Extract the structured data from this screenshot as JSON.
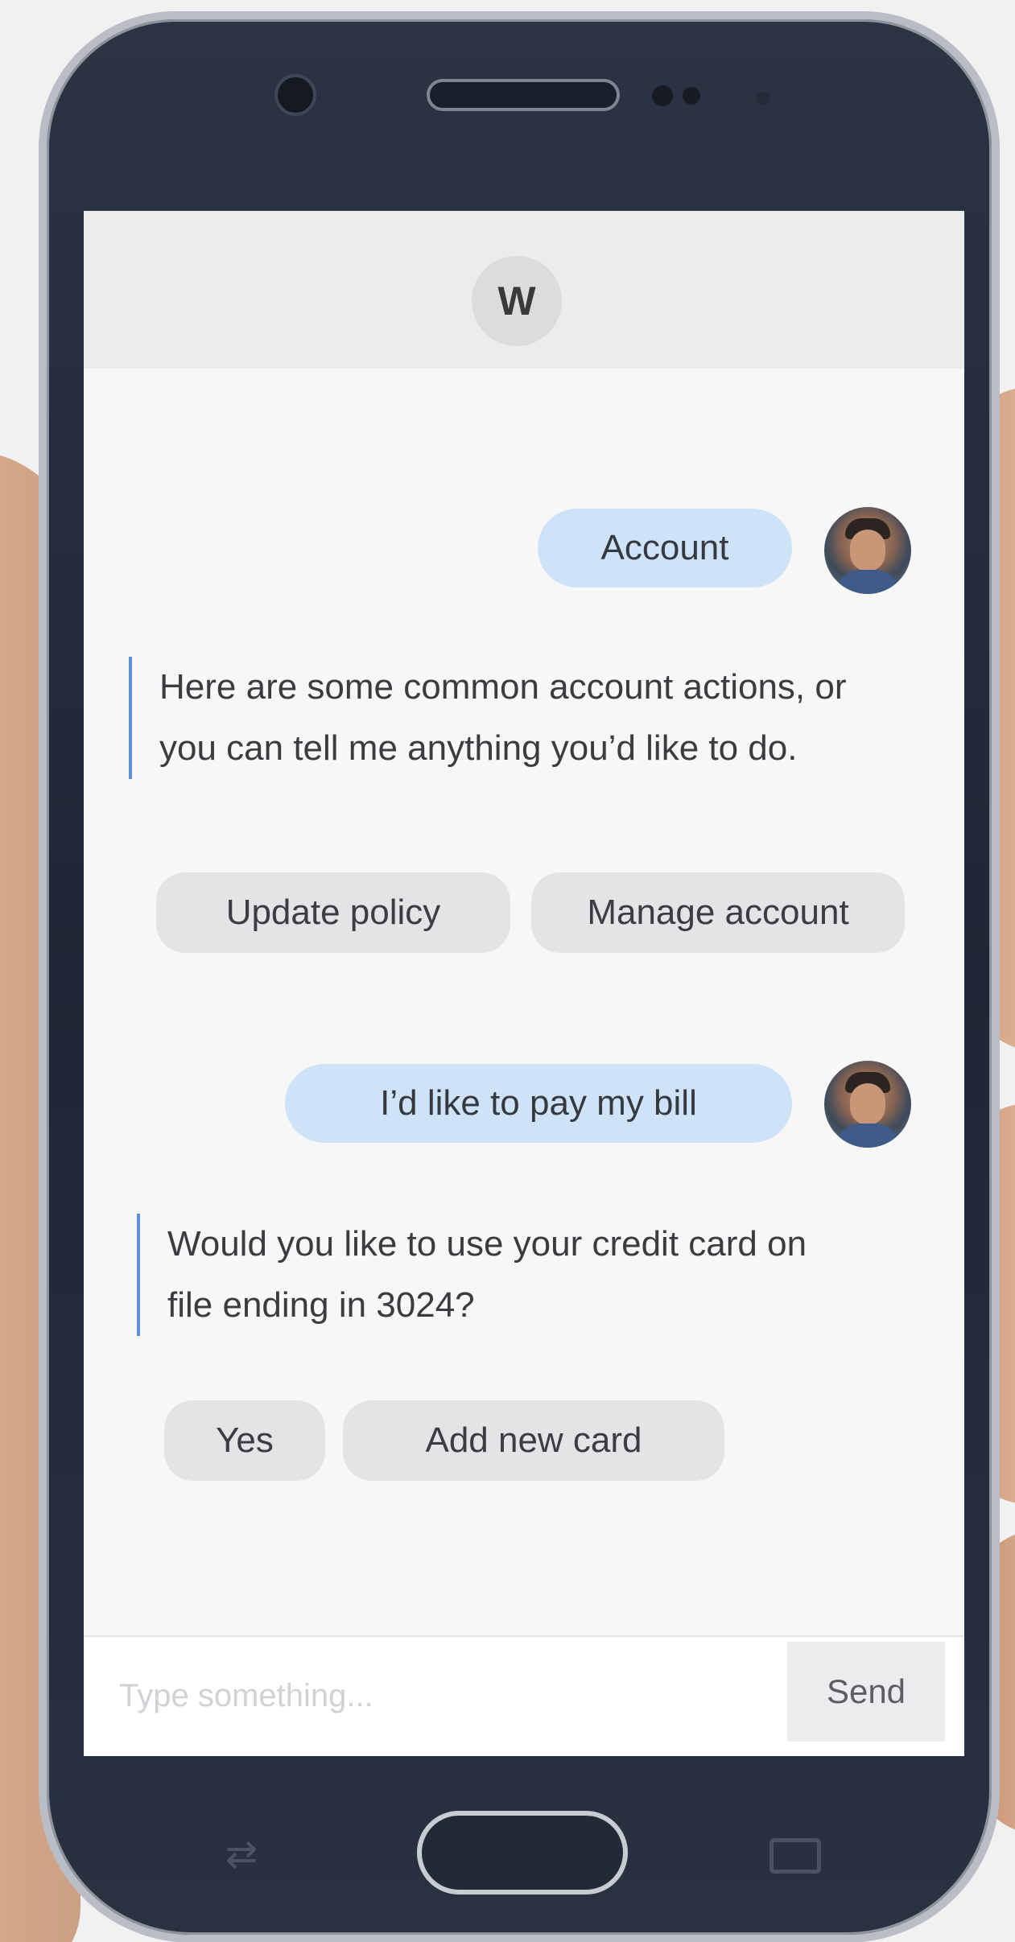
{
  "header": {
    "logo_letter": "W"
  },
  "messages": {
    "user_1": "Account",
    "bot_1": "Here are some common account actions, or you can tell me anything you’d like to do.",
    "chips_1": [
      "Update policy",
      "Manage account"
    ],
    "user_2": "I’d like to pay my bill",
    "bot_2": "Would you like to use your credit card on file ending in 3024?",
    "chips_2": [
      "Yes",
      "Add new card"
    ]
  },
  "input": {
    "placeholder": "Type something...",
    "send_label": "Send"
  },
  "colors": {
    "user_bubble": "#cfe3f8",
    "bot_accent": "#5b8fd6",
    "chip_bg": "#e4e4e6",
    "phone_body": "#1f2736"
  },
  "icons": [
    "camera-icon",
    "speaker-grille-icon",
    "home-button-icon",
    "back-nav-icon",
    "recent-apps-icon",
    "user-avatar-icon"
  ]
}
